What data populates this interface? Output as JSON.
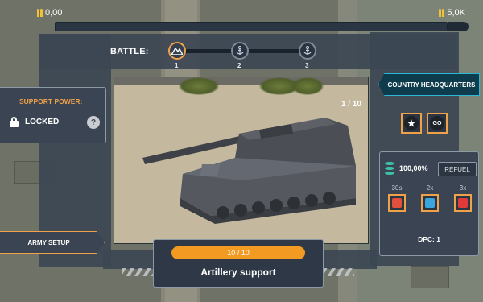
{
  "resources": {
    "left_value": "0,00",
    "right_value": "5,0K",
    "accent": "#f1c233"
  },
  "battle": {
    "label": "BATTLE:",
    "stages": [
      {
        "number": "1",
        "icon": "mountain-icon",
        "state": "active"
      },
      {
        "number": "2",
        "icon": "anchor-icon",
        "state": "locked"
      },
      {
        "number": "3",
        "icon": "anchor-icon",
        "state": "locked"
      }
    ]
  },
  "viewport": {
    "counter": "1 / 10"
  },
  "support": {
    "title": "SUPPORT POWER:",
    "status": "LOCKED",
    "help_symbol": "?"
  },
  "army_setup": {
    "label": "ARMY SETUP"
  },
  "hq": {
    "label": "COUNTRY HEADQUARTERS",
    "medals": [
      {
        "icon": "star-medal-icon",
        "text": ""
      },
      {
        "icon": "go-medal-icon",
        "text": "GO"
      }
    ]
  },
  "fuel": {
    "percent": "100,00%",
    "refuel_label": "REFUEL"
  },
  "boosts": [
    {
      "label": "30s",
      "color": "#e0503a"
    },
    {
      "label": "2x",
      "color": "#39a6e0"
    },
    {
      "label": "3x",
      "color": "#e03a3a"
    }
  ],
  "dpc": {
    "label": "DPC: 1"
  },
  "unit_card": {
    "count": "10 / 10",
    "title": "Artillery support",
    "accent": "#f39a23"
  }
}
